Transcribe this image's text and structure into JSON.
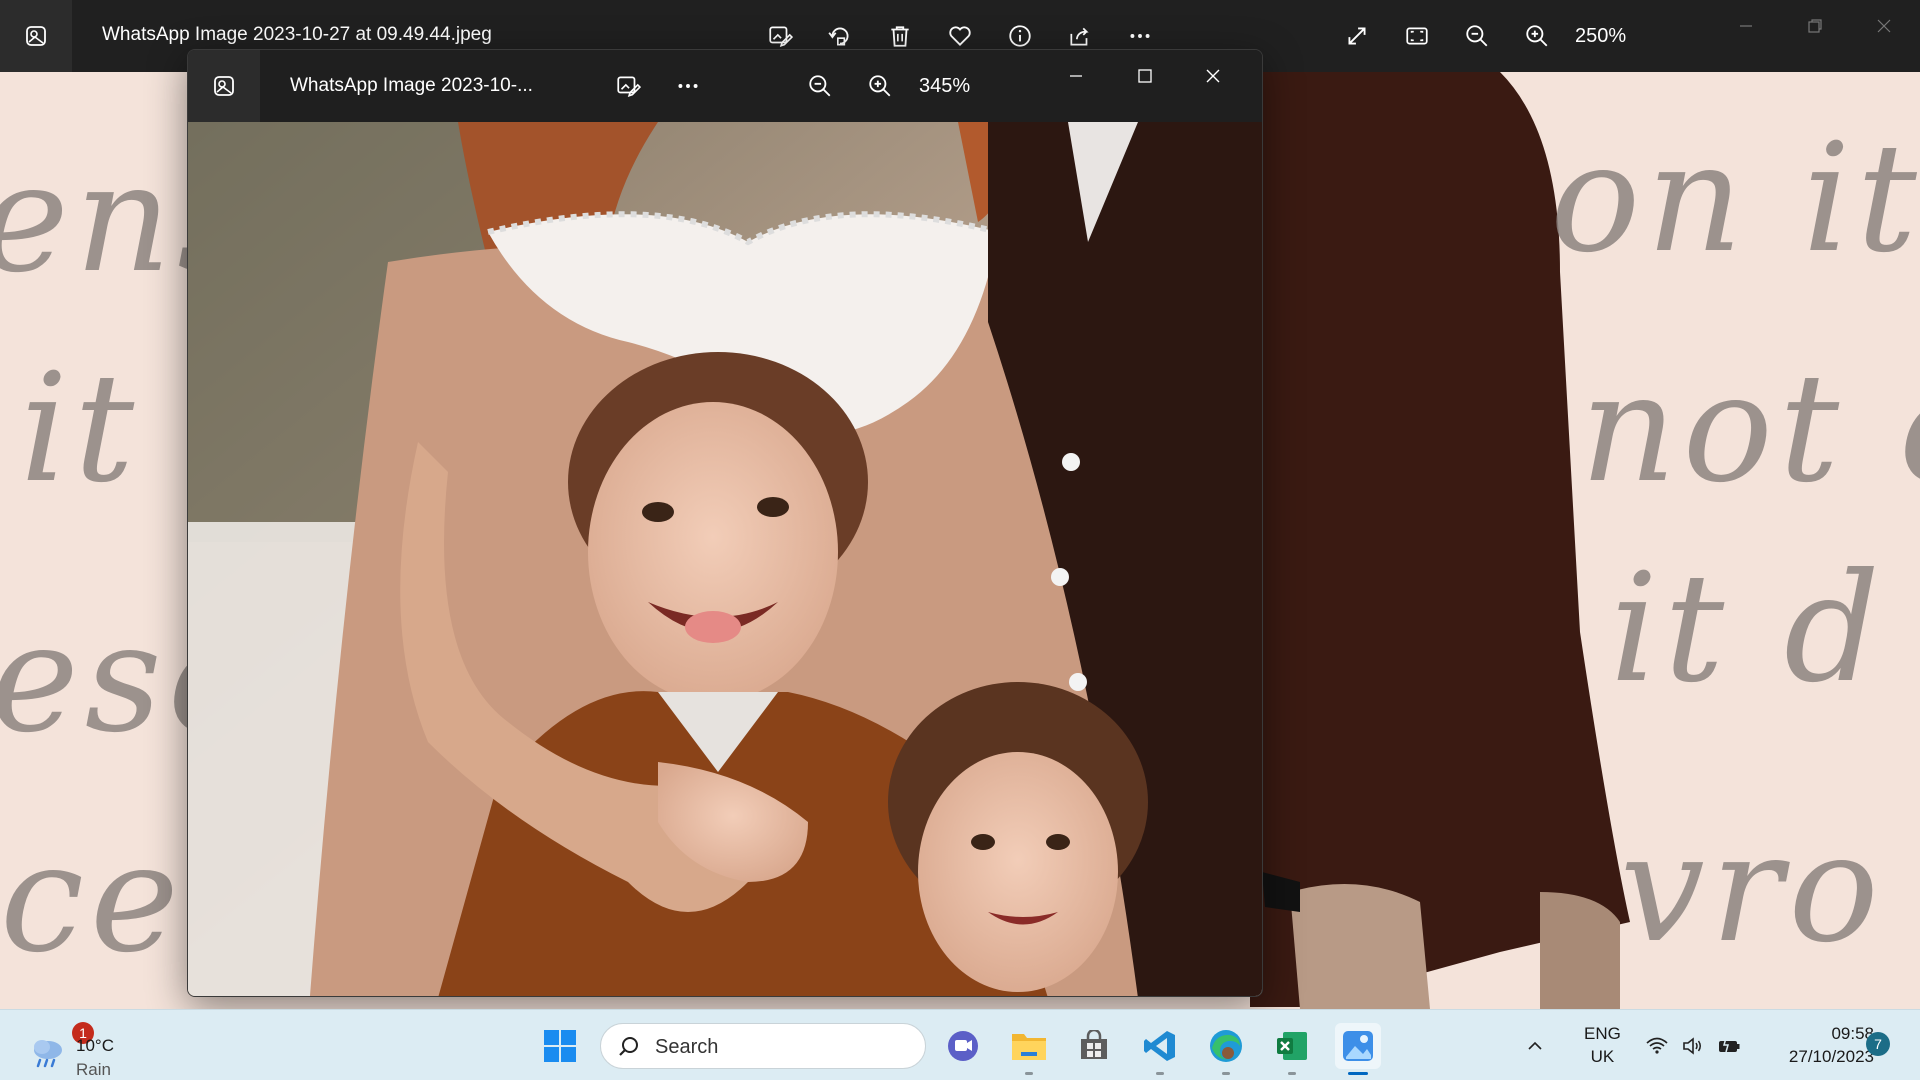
{
  "main_window": {
    "title": "WhatsApp Image 2023-10-27 at 09.49.44.jpeg",
    "zoom_level": "250%",
    "toolbar_icons": [
      "edit-image-icon",
      "rotate-icon",
      "delete-icon",
      "favorite-icon",
      "info-icon",
      "share-icon",
      "more-icon"
    ],
    "view_icons": [
      "fullscreen-icon",
      "fit-window-icon",
      "zoom-out-icon",
      "zoom-in-icon"
    ],
    "background_script_words": [
      "ens",
      "on it",
      "it",
      "not o",
      "ese",
      "it d",
      "ce",
      "vro"
    ]
  },
  "inner_window": {
    "title": "WhatsApp Image 2023-10-...",
    "zoom_level": "345%"
  },
  "taskbar": {
    "weather": {
      "temp": "10°C",
      "condition": "Rain",
      "badge": "1"
    },
    "search_placeholder": "Search",
    "apps": [
      "teams",
      "file-explorer",
      "store",
      "vscode",
      "edge",
      "excel",
      "photos"
    ],
    "language": {
      "line1": "ENG",
      "line2": "UK"
    },
    "clock": {
      "time": "09:58",
      "date": "27/10/2023"
    },
    "notification_count": "7"
  }
}
